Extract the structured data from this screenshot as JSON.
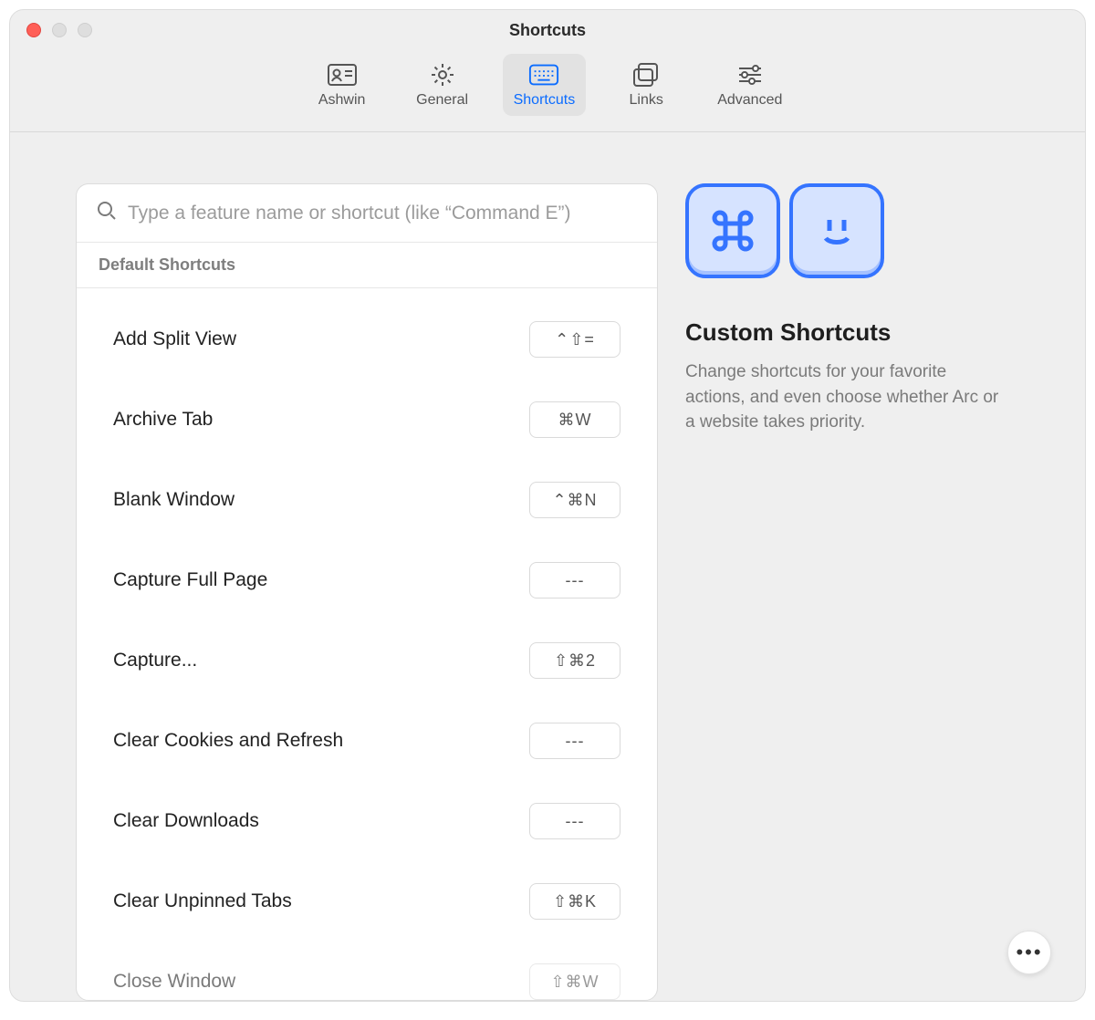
{
  "window": {
    "title": "Shortcuts"
  },
  "toolbar": {
    "tabs": [
      {
        "label": "Ashwin",
        "icon": "profile-card-icon"
      },
      {
        "label": "General",
        "icon": "gear-icon"
      },
      {
        "label": "Shortcuts",
        "icon": "keyboard-icon",
        "selected": true
      },
      {
        "label": "Links",
        "icon": "windows-icon"
      },
      {
        "label": "Advanced",
        "icon": "sliders-icon"
      }
    ]
  },
  "search": {
    "placeholder": "Type a feature name or shortcut (like “Command E”)"
  },
  "section_header": "Default Shortcuts",
  "shortcuts": [
    {
      "name": "Add Split View",
      "keys": "⌃⇧="
    },
    {
      "name": "Archive Tab",
      "keys": "⌘W"
    },
    {
      "name": "Blank Window",
      "keys": "⌃⌘N"
    },
    {
      "name": "Capture Full Page",
      "keys": "---"
    },
    {
      "name": "Capture...",
      "keys": "⇧⌘2"
    },
    {
      "name": "Clear Cookies and Refresh",
      "keys": "---"
    },
    {
      "name": "Clear Downloads",
      "keys": "---"
    },
    {
      "name": "Clear Unpinned Tabs",
      "keys": "⇧⌘K"
    },
    {
      "name": "Close Window",
      "keys": "⇧⌘W"
    }
  ],
  "info": {
    "title": "Custom Shortcuts",
    "desc": "Change shortcuts for your favorite actions, and even choose whether Arc or a website takes priority."
  },
  "more_button": "•••"
}
